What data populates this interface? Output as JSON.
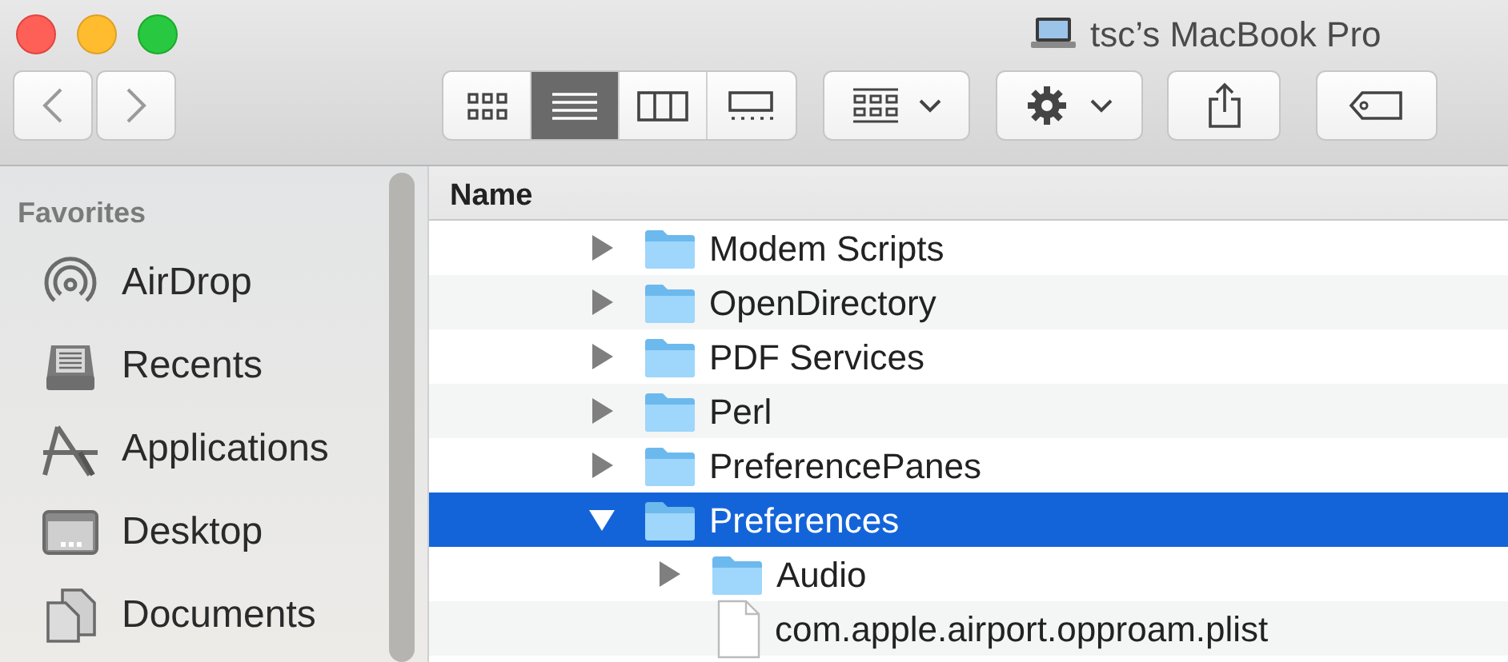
{
  "window": {
    "title": "tsc’s MacBook Pro"
  },
  "toolbar": {
    "view_modes": [
      {
        "kind": "icons",
        "selected": false
      },
      {
        "kind": "list",
        "selected": true
      },
      {
        "kind": "columns",
        "selected": false
      },
      {
        "kind": "gallery",
        "selected": false
      }
    ]
  },
  "sidebar": {
    "heading": "Favorites",
    "items": [
      {
        "label": "AirDrop",
        "kind": "airdrop"
      },
      {
        "label": "Recents",
        "kind": "recents"
      },
      {
        "label": "Applications",
        "kind": "applications"
      },
      {
        "label": "Desktop",
        "kind": "desktop"
      },
      {
        "label": "Documents",
        "kind": "documents"
      }
    ]
  },
  "file_list": {
    "columns": [
      "Name"
    ],
    "rows": [
      {
        "name": "Modem Scripts",
        "kind": "folder",
        "expanded": false,
        "selected": false
      },
      {
        "name": "OpenDirectory",
        "kind": "folder",
        "expanded": false,
        "selected": false
      },
      {
        "name": "PDF Services",
        "kind": "folder",
        "expanded": false,
        "selected": false
      },
      {
        "name": "Perl",
        "kind": "folder",
        "expanded": false,
        "selected": false
      },
      {
        "name": "PreferencePanes",
        "kind": "folder",
        "expanded": false,
        "selected": false
      },
      {
        "name": "Preferences",
        "kind": "folder",
        "expanded": true,
        "selected": true,
        "children": [
          {
            "name": "Audio",
            "kind": "folder",
            "expanded": false,
            "selected": false
          },
          {
            "name": "com.apple.airport.opproam.plist",
            "kind": "file",
            "selected": false
          }
        ]
      }
    ]
  }
}
